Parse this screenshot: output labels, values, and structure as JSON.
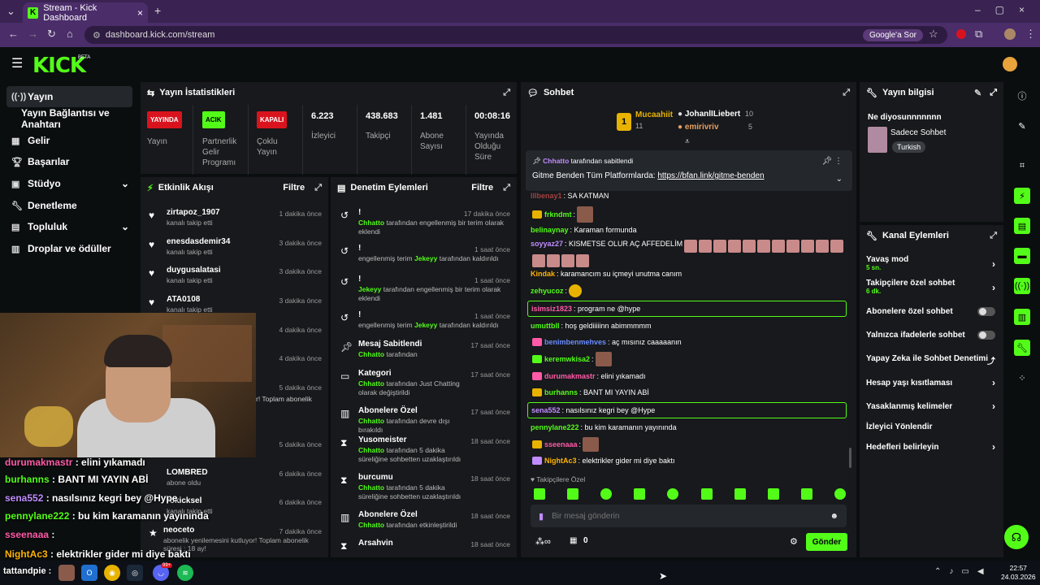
{
  "browser": {
    "tab_title": "Stream - Kick Dashboard",
    "url": "dashboard.kick.com/stream",
    "search_chip": "Google'a Sor"
  },
  "app": {
    "logo": "KICK",
    "beta": "BETA"
  },
  "sidebar": {
    "items": [
      {
        "label": "Yayın",
        "icon": "stream-icon"
      },
      {
        "label": "Yayın Bağlantısı ve Anahtarı",
        "icon": ""
      },
      {
        "label": "Gelir",
        "icon": "revenue-icon"
      },
      {
        "label": "Başarılar",
        "icon": "trophy-icon"
      },
      {
        "label": "Stüdyo",
        "icon": "studio-icon"
      },
      {
        "label": "Denetleme",
        "icon": "wrench-icon"
      },
      {
        "label": "Topluluk",
        "icon": "community-icon"
      },
      {
        "label": "Droplar ve ödüller",
        "icon": "gift-icon"
      }
    ]
  },
  "stats": {
    "title": "Yayın İstatistikleri",
    "items": [
      {
        "badge": "YAYINDA",
        "label": "Yayın",
        "color": "#d9131e"
      },
      {
        "badge": "ACIK",
        "label": "Partnerlik Gelir Programı",
        "color": "#53fc18"
      },
      {
        "badge": "KAPALI",
        "label": "Çoklu Yayın",
        "color": "#d9131e"
      },
      {
        "value": "6.223",
        "label": "İzleyici"
      },
      {
        "value": "438.683",
        "label": "Takipçi"
      },
      {
        "value": "1.481",
        "label": "Abone Sayısı"
      },
      {
        "value": "00:08:16",
        "label": "Yayında Olduğu Süre"
      }
    ]
  },
  "activity": {
    "title": "Etkinlik Akışı",
    "filter": "Filtre",
    "rows": [
      {
        "name": "zirtapoz_1907",
        "sub": "kanalı takip etti",
        "time": "1 dakika önce"
      },
      {
        "name": "enesdasdemir34",
        "sub": "kanalı takip etti",
        "time": "3 dakika önce"
      },
      {
        "name": "duygusalatasi",
        "sub": "kanalı takip etti",
        "time": "3 dakika önce"
      },
      {
        "name": "ATA0108",
        "sub": "kanalı takip etti",
        "time": "3 dakika önce"
      },
      {
        "name": "",
        "sub": "",
        "time": "4 dakika önce"
      },
      {
        "name": "",
        "sub": "",
        "time": "4 dakika önce"
      },
      {
        "name": "",
        "sub": "r! Toplam abonelik",
        "time": "5 dakika önce"
      },
      {
        "name": "",
        "sub": "",
        "time": "5 dakika önce"
      },
      {
        "name": "LOMBRED",
        "sub": "abone oldu",
        "time": "6 dakika önce"
      },
      {
        "name": "rokicksel",
        "sub": "kanalı takip etti",
        "time": "6 dakika önce"
      },
      {
        "name": "neoceto",
        "sub": "abonelik yenilemesini kutluyor! Toplam abonelik süresi : 18 ay!",
        "time": "7 dakika önce"
      }
    ]
  },
  "moderation": {
    "title": "Denetim Eylemleri",
    "filter": "Filtre",
    "rows": [
      {
        "title": "!",
        "desc_pre": "",
        "desc_hl": "Chhatto",
        "desc_post": " tarafından engellenmiş bir terim olarak eklendi",
        "time": "17 dakika önce",
        "icon": "undo-icon"
      },
      {
        "title": "!",
        "desc_pre": "engellenmiş terim ",
        "desc_hl": "Jekeyy",
        "desc_post": " tarafından kaldırıldı",
        "time": "1 saat önce",
        "icon": "undo-icon"
      },
      {
        "title": "!",
        "desc_pre": "",
        "desc_hl": "Jekeyy",
        "desc_post": " tarafından engellenmiş bir terim olarak eklendi",
        "time": "1 saat önce",
        "icon": "undo-icon"
      },
      {
        "title": "!",
        "desc_pre": "engellenmiş terim ",
        "desc_hl": "Jekeyy",
        "desc_post": " tarafından kaldırıldı",
        "time": "1 saat önce",
        "icon": "undo-icon"
      },
      {
        "title": "Mesaj Sabitlendi",
        "desc_pre": "",
        "desc_hl": "Chhatto",
        "desc_post": " tarafından",
        "time": "17 saat önce",
        "icon": "pin-icon"
      },
      {
        "title": "Kategori",
        "desc_pre": "",
        "desc_hl": "Chhatto",
        "desc_post": " tarafından Just Chatting olarak değiştirildi",
        "time": "17 saat önce",
        "icon": "category-icon"
      },
      {
        "title": "Abonelere Özel",
        "desc_pre": "",
        "desc_hl": "Chhatto",
        "desc_post": " tarafından devre dışı bırakıldı",
        "time": "17 saat önce",
        "icon": "gift-icon"
      },
      {
        "title": "Yusomeister",
        "desc_pre": "",
        "desc_hl": "Chhatto",
        "desc_post": " tarafından 5 dakika süreliğine sohbetten uzaklaştırıldı",
        "time": "18 saat önce",
        "icon": "hourglass-icon"
      },
      {
        "title": "burcumu",
        "desc_pre": "",
        "desc_hl": "Chhatto",
        "desc_post": " tarafından 5 dakika süreliğine sohbetten uzaklaştırıldı",
        "time": "18 saat önce",
        "icon": "hourglass-icon"
      },
      {
        "title": "Abonelere Özel",
        "desc_pre": "",
        "desc_hl": "Chhatto",
        "desc_post": " tarafından etkinleştirildi",
        "time": "18 saat önce",
        "icon": "gift-icon"
      },
      {
        "title": "Arsahvin",
        "desc_pre": "",
        "desc_hl": "",
        "desc_post": "",
        "time": "18 saat önce",
        "icon": "hourglass-icon"
      }
    ]
  },
  "chat": {
    "title": "Sohbet",
    "leaderboard": [
      {
        "name": "Mucaahiit",
        "count": "11",
        "color": "#e8b300"
      },
      {
        "name": "JohanlILiebert",
        "count": "10",
        "color": "#ffffff"
      },
      {
        "name": "emirivriv",
        "count": "5",
        "color": "#e8a060"
      }
    ],
    "pinned_by": "Chhatto",
    "pinned_by_suffix": " tarafından sabitlendi",
    "pinned_text": "Gitme Benden Tüm Platformlarda: ",
    "pinned_link": "https://bfan.link/gitme-benden",
    "messages": [
      {
        "user": "lllbenay1",
        "color": "#ff5a5a",
        "text": ": SA KATMAN"
      },
      {
        "user": "frkndmt",
        "color": "#53fc18",
        "text": ":"
      },
      {
        "user": "belinaynay",
        "color": "#53fc18",
        "text": ": Karaman formunda"
      },
      {
        "user": "soyyaz27",
        "color": "#c08cff",
        "text": ": KISMETSE OLUR AÇ AFFEDELİM"
      },
      {
        "user": "Kindak",
        "color": "#ffb300",
        "text": ": karamancım su içmeyi unutma canım"
      },
      {
        "user": "zehyucoz",
        "color": "#53fc18",
        "text": ":"
      },
      {
        "user": "isimsiz1823",
        "color": "#ff5aa8",
        "text": ": program ne @hype"
      },
      {
        "user": "umuttbll",
        "color": "#53fc18",
        "text": ": hoş geldiiiiinn abimmmmm"
      },
      {
        "user": "benimbenmehves",
        "color": "#6a8cff",
        "text": ": aç mısınız caaaaanın"
      },
      {
        "user": "keremwkisa2",
        "color": "#53fc18",
        "text": ":"
      },
      {
        "user": "durumakmastr",
        "color": "#ff5aa8",
        "text": ": elini yıkamadı"
      },
      {
        "user": "burhanns",
        "color": "#53fc18",
        "text": ": BANT MI YAYIN ABİ"
      },
      {
        "user": "sena552",
        "color": "#c08cff",
        "text": ": nasılsınız kegri bey @Hype"
      },
      {
        "user": "pennylane222",
        "color": "#53fc18",
        "text": ": bu kim karamanın yayınında"
      },
      {
        "user": "sseenaaa",
        "color": "#ff5aa8",
        "text": ":"
      },
      {
        "user": "NightAc3",
        "color": "#ffb300",
        "text": ": elektrikler gider mi diye baktı"
      }
    ],
    "follower_only": "Takipçilere Özel",
    "input_placeholder": "Bir mesaj gönderin",
    "points": "0",
    "send_label": "Gönder"
  },
  "stream_info": {
    "title": "Yayın bilgisi",
    "stream_title": "Ne diyosunnnnnnn",
    "category": "Sadece Sohbet",
    "tag": "Turkish"
  },
  "channel_actions": {
    "title": "Kanal Eylemleri",
    "items": [
      {
        "label": "Yavaş mod",
        "sub": "5 sn.",
        "type": "chevron"
      },
      {
        "label": "Takipçilere özel sohbet",
        "sub": "6 dk.",
        "type": "chevron"
      },
      {
        "label": "Abonelere özel sohbet",
        "sub": "",
        "type": "toggle"
      },
      {
        "label": "Yalnızca ifadelerle sohbet",
        "sub": "",
        "type": "toggle"
      },
      {
        "label": "Yapay Zeka ile Sohbet Denetimi",
        "sub": "",
        "type": "external"
      },
      {
        "label": "Hesap yaşı kısıtlaması",
        "sub": "",
        "type": "chevron"
      },
      {
        "label": "Yasaklanmış kelimeler",
        "sub": "",
        "type": "chevron"
      },
      {
        "label": "İzleyici Yönlendir",
        "sub": "",
        "type": "none"
      },
      {
        "label": "Hedefleri belirleyin",
        "sub": "",
        "type": "chevron"
      }
    ]
  },
  "overlay_chat": [
    {
      "user": "durumakmastr",
      "color": "#ff5aa8",
      "text": " : elini yıkamadı"
    },
    {
      "user": "burhanns",
      "color": "#53fc18",
      "text": " : BANT MI YAYIN ABİ"
    },
    {
      "user": "sena552",
      "color": "#c08cff",
      "text": " : nasılsınız kegri bey @Hype"
    },
    {
      "user": "pennylane222",
      "color": "#53fc18",
      "text": " : bu kim karamanın yayınında"
    },
    {
      "user": "sseenaaa",
      "color": "#ff5aa8",
      "text": " :"
    },
    {
      "user": "NightAc3",
      "color": "#ffb300",
      "text": " : elektrikler gider mi diye baktı"
    },
    {
      "user": "tattandpie",
      "color": "#ffffff",
      "text": " :"
    }
  ],
  "taskbar": {
    "time": "22:57",
    "date": "24.03.2026",
    "badge": "99+"
  },
  "colors": {
    "accent": "#53fc18",
    "panel": "#17191c",
    "live": "#d9131e"
  }
}
